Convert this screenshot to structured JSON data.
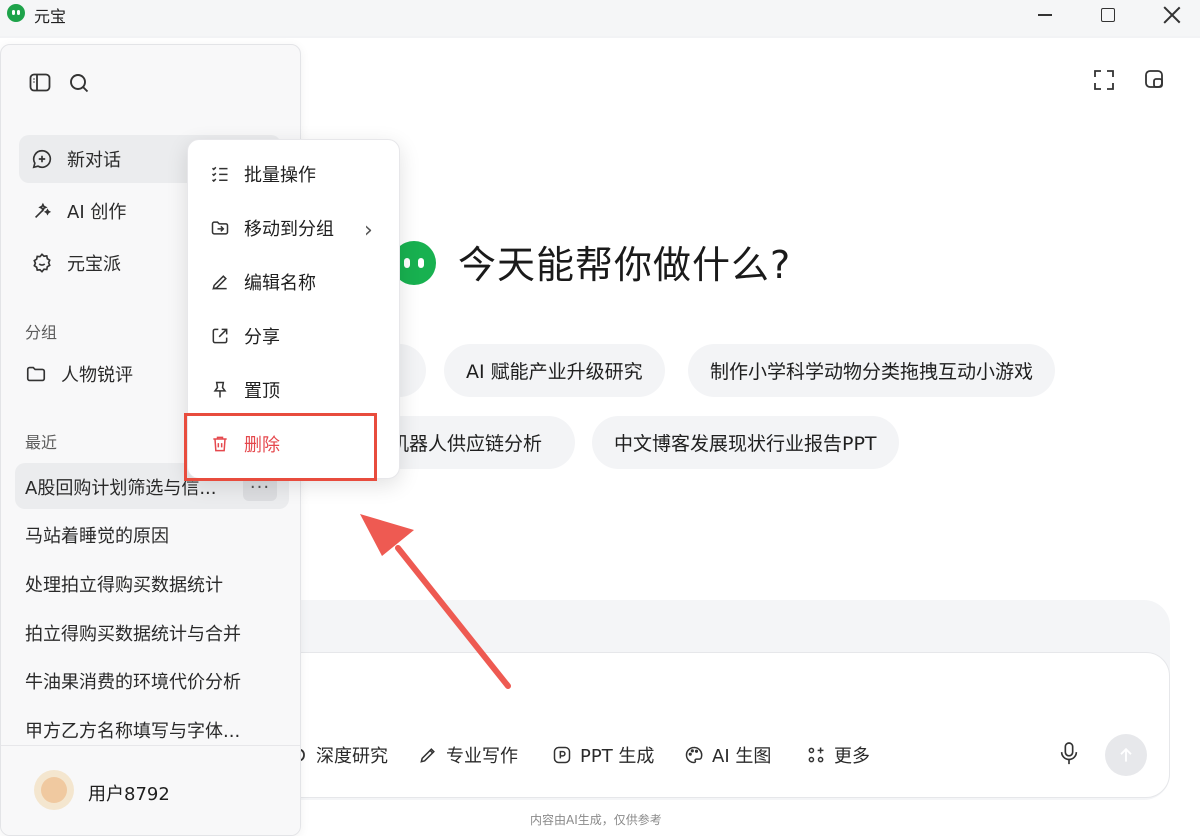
{
  "app": {
    "title": "元宝"
  },
  "sidebar": {
    "nav": [
      {
        "label": "新对话",
        "icon": "chat-plus-icon"
      },
      {
        "label": "AI 创作",
        "icon": "magic-wand-icon"
      },
      {
        "label": "元宝派",
        "icon": "community-icon"
      }
    ],
    "groups_label": "分组",
    "groups": [
      {
        "label": "人物锐评",
        "icon": "folder-icon"
      }
    ],
    "recent_label": "最近",
    "recent": [
      "A股回购计划筛选与信...",
      "马站着睡觉的原因",
      "处理拍立得购买数据统计",
      "拍立得购买数据统计与合并",
      "牛油果消费的环境代价分析",
      "甲方乙方名称填写与字体..."
    ],
    "more_label": "···",
    "user": {
      "name": "用户8792"
    }
  },
  "context_menu": {
    "items": [
      {
        "label": "批量操作",
        "icon": "checklist-icon"
      },
      {
        "label": "移动到分组",
        "icon": "move-folder-icon",
        "has_submenu": true
      },
      {
        "label": "编辑名称",
        "icon": "pencil-icon"
      },
      {
        "label": "分享",
        "icon": "share-icon"
      },
      {
        "label": "置顶",
        "icon": "pin-icon"
      },
      {
        "label": "删除",
        "icon": "trash-icon",
        "danger": true
      }
    ],
    "submenu_glyph": "›"
  },
  "main": {
    "hero_title": "今天能帮你做什么?",
    "suggestions_row1": [
      "AI 赋能产业升级研究",
      "制作小学科学动物分类拖拽互动小游戏"
    ],
    "suggestions_row2": [
      "机器人供应链分析",
      "中文博客发展现状行业报告PPT"
    ],
    "tools": [
      {
        "label": "深度研究",
        "icon": "deep-research-icon"
      },
      {
        "label": "专业写作",
        "icon": "pen-icon"
      },
      {
        "label": "PPT 生成",
        "icon": "ppt-icon"
      },
      {
        "label": "AI 生图",
        "icon": "palette-icon"
      },
      {
        "label": "更多",
        "icon": "grid-more-icon"
      }
    ],
    "footnote": "内容由AI生成，仅供参考"
  },
  "colors": {
    "brand_green": "#18b150",
    "danger_red": "#e5484d",
    "annotation_red": "#e84c3d"
  }
}
